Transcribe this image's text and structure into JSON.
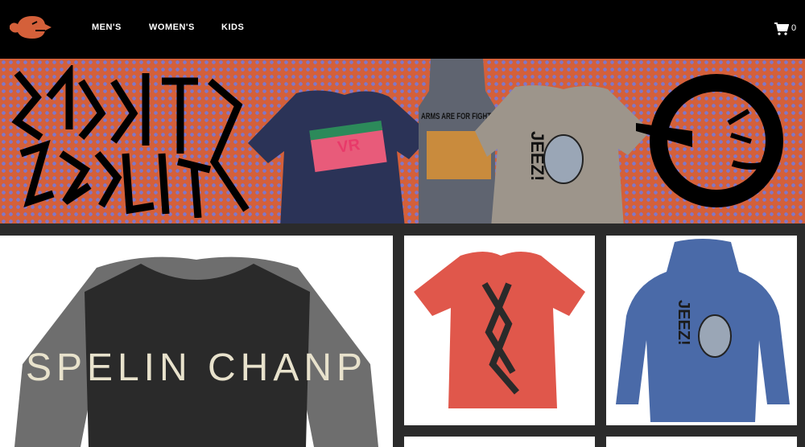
{
  "nav": {
    "links": [
      {
        "label": "MEN'S"
      },
      {
        "label": "WOMEN'S"
      },
      {
        "label": "KIDS"
      }
    ],
    "cart_count": "0"
  },
  "hero": {
    "brand_art": [
      "BURRITO",
      "GOBLINS"
    ],
    "shirt_texts": {
      "vr": "VR",
      "hoodie": "ARMS ARE FOR FIGHTIN",
      "jeez": "JEEZ!"
    }
  },
  "products": [
    {
      "id": "spelin-champ",
      "text": "SPELIN CHANP",
      "color": "#2a2a2a",
      "sleeve_color": "#6e6e6e"
    },
    {
      "id": "red-tee",
      "color": "#e0574b"
    },
    {
      "id": "jeez-hoodie",
      "text": "JEEZ!",
      "color": "#4a6aa8"
    }
  ],
  "colors": {
    "nav_bg": "#000000",
    "hero_orange": "#d4603a",
    "hero_dots": "#7f77c9",
    "page_bg": "#2b2b2b"
  }
}
